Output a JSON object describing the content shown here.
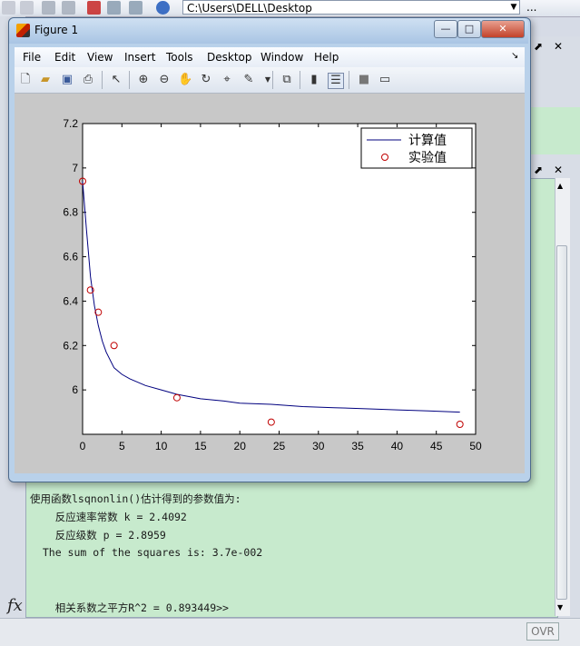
{
  "desktop": {
    "path": "C:\\Users\\DELL\\Desktop",
    "path_more": "...",
    "status_ovr": "OVR"
  },
  "figure": {
    "title": "Figure 1",
    "menu": [
      "File",
      "Edit",
      "View",
      "Insert",
      "Tools",
      "Desktop",
      "Window",
      "Help"
    ],
    "menu_arrow": "↘",
    "window_buttons": {
      "minimize": "—",
      "maximize": "□",
      "close": "✕"
    }
  },
  "chart_data": {
    "type": "line",
    "title": "",
    "xlabel": "",
    "ylabel": "",
    "xlim": [
      0,
      50
    ],
    "ylim": [
      5.8,
      7.2
    ],
    "xticks": [
      0,
      5,
      10,
      15,
      20,
      25,
      30,
      35,
      40,
      45,
      50
    ],
    "yticks": [
      6,
      6.2,
      6.4,
      6.6,
      6.8,
      7,
      7.2
    ],
    "ytick_labels": [
      "6",
      "6.2",
      "6.4",
      "6.6",
      "6.8",
      "7",
      "7.2"
    ],
    "grid": false,
    "legend_position": "top-right",
    "series": [
      {
        "name": "计算值",
        "style": "line",
        "color": "#00007f",
        "x": [
          0,
          0.5,
          1,
          1.5,
          2,
          2.5,
          3,
          4,
          5,
          6,
          8,
          10,
          12,
          15,
          18,
          20,
          24,
          28,
          32,
          36,
          40,
          44,
          48
        ],
        "y": [
          6.94,
          6.72,
          6.51,
          6.38,
          6.29,
          6.22,
          6.17,
          6.1,
          6.07,
          6.05,
          6.02,
          6.0,
          5.98,
          5.96,
          5.95,
          5.94,
          5.935,
          5.925,
          5.92,
          5.915,
          5.91,
          5.905,
          5.9
        ]
      },
      {
        "name": "实验值",
        "style": "marker-circle",
        "color": "#c00000",
        "x": [
          0,
          1,
          2,
          4,
          12,
          24,
          48
        ],
        "y": [
          6.94,
          6.45,
          6.35,
          6.2,
          5.965,
          5.855,
          5.845
        ]
      }
    ]
  },
  "command_window": {
    "lines": [
      "使用函数lsqnonlin()估计得到的参数值为:",
      "    反应速率常数 k = 2.4092",
      "    反应级数 p = 2.8959",
      "  The sum of the squares is: 3.7e-002",
      "    相关系数之平方R^2 = 0.893449>>"
    ]
  },
  "colors": {
    "command_bg": "#c7eacd",
    "figure_frame": "#b9d1ea",
    "plot_line": "#00007f",
    "marker": "#c00000"
  },
  "icons": {
    "fx": "fx"
  }
}
